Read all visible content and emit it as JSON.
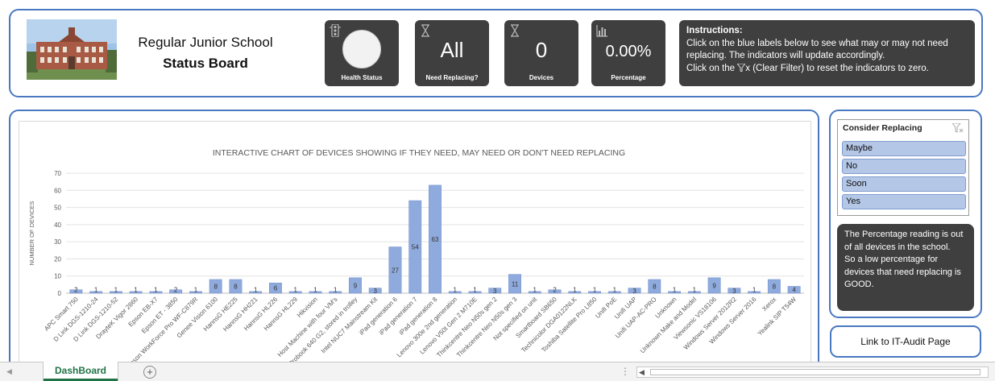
{
  "header": {
    "school_name": "Regular Junior School",
    "board_title": "Status Board"
  },
  "tiles": [
    {
      "label": "Health Status",
      "value": "",
      "icon": "traffic-light-icon"
    },
    {
      "label": "Need Replacing?",
      "value": "All",
      "icon": "hourglass-icon"
    },
    {
      "label": "Devices",
      "value": "0",
      "icon": "hourglass-icon"
    },
    {
      "label": "Percentage",
      "value": "0.00%",
      "icon": "bar-chart-icon"
    }
  ],
  "instructions": {
    "title": "Instructions:",
    "line1": "Click on the blue labels below to see what may or may not need replacing.  The indicators will update accordingly.",
    "line2_pre": "Click on the ",
    "line2_post": "x (Clear Filter) to reset the indicators to zero."
  },
  "slicer": {
    "title": "Consider Replacing",
    "items": [
      "Maybe",
      "No",
      "Soon",
      "Yes"
    ]
  },
  "note": "The Percentage reading is out of all devices in the school.\nSo a low percentage for devices that need replacing is GOOD.",
  "link_label": "Link to IT-Audit Page",
  "sheet_tab": "DashBoard",
  "colors": {
    "bar": "#8faadc",
    "bar_stroke": "#6f8fcf",
    "tile": "#3f3f3f",
    "border": "#4a78c0"
  },
  "chart_data": {
    "type": "bar",
    "title": "INTERACTIVE CHART OF DEVICES SHOWING IF THEY NEED, MAY NEED OR DON'T NEED REPLACING",
    "ylabel": "NUMBER OF DEVICES",
    "ylim": [
      0,
      70
    ],
    "yticks": [
      0,
      10,
      20,
      30,
      40,
      50,
      60,
      70
    ],
    "categories": [
      "APC Smart 750",
      "D Link DGS-1210-24",
      "D Link DGS-1210-52",
      "DrayteK Vigor 2860",
      "Epson EB-X7",
      "Epson ET - 3850",
      "Epson WorkForce Pro WF-C879R",
      "Genee Vision 6100",
      "HannsG HE225",
      "HannsG HH221",
      "HannsG HL226",
      "HannsG HL229",
      "Hikvision",
      "Host Machine with four VM's",
      "HP Probook 640 G2, stored in trolley",
      "Intel NUC7 Mainstream Kit",
      "iPad generation 6",
      "iPad generation 7",
      "iPad generation 8",
      "Lenovo 300e 2nd generation",
      "Lenovo V50t Gen 2 M710E",
      "Thinkcentre Neo N50s gen 2",
      "Thinkcentre Neo N50s gen 3",
      "Not specified on unit",
      "Smartboard SB650",
      "Technicolor DGA0122NLK",
      "Toshiba Satellite Pro L850",
      "Unifi PoE",
      "Unifi UAP",
      "Unifi UAP-AC-PRO",
      "Unknown",
      "Unknown Make and Model",
      "Viewsonic VS18106",
      "Windows Server 2012R2",
      "Windows Server 2016",
      "Xerox",
      "Yealink SIP T54W"
    ],
    "values": [
      2,
      1,
      1,
      1,
      1,
      2,
      1,
      8,
      8,
      1,
      6,
      1,
      1,
      1,
      9,
      3,
      27,
      54,
      63,
      1,
      1,
      3,
      11,
      1,
      2,
      1,
      1,
      1,
      3,
      8,
      1,
      1,
      9,
      3,
      1,
      8,
      4
    ],
    "grid": true,
    "legend": "none"
  }
}
